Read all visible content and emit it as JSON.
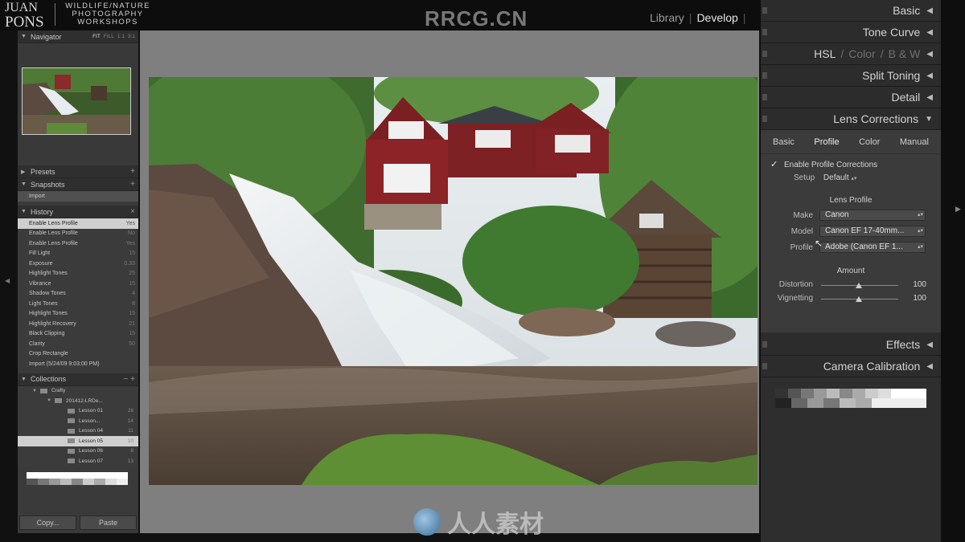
{
  "top": {
    "brand_line1": "JUAN",
    "brand_line2": "PONS",
    "tagline_1": "WILDLIFE/NATURE",
    "tagline_2": "PHOTOGRAPHY",
    "tagline_3": "WORKSHOPS",
    "watermark": "RRCG.CN",
    "modules": [
      "Library",
      "Develop"
    ],
    "active_module": "Develop",
    "separator": "|"
  },
  "navigator": {
    "title": "Navigator",
    "zoom": [
      "FIT",
      "FILL",
      "1:1",
      "3:1"
    ]
  },
  "presets": {
    "title": "Presets"
  },
  "snapshots": {
    "title": "Snapshots",
    "items": [
      "Import"
    ]
  },
  "history": {
    "title": "History",
    "items": [
      {
        "label": "Enable Lens Profile",
        "value": "Yes"
      },
      {
        "label": "Enable Lens Profile",
        "value": "No"
      },
      {
        "label": "Enable Lens Profile",
        "value": "Yes"
      },
      {
        "label": "Fill Light",
        "value": "15"
      },
      {
        "label": "Exposure",
        "value": "0.33"
      },
      {
        "label": "Highlight Tones",
        "value": "25"
      },
      {
        "label": "Vibrance",
        "value": "15"
      },
      {
        "label": "Shadow Tones",
        "value": "4"
      },
      {
        "label": "Light Tones",
        "value": "8"
      },
      {
        "label": "Highlight Tones",
        "value": "15"
      },
      {
        "label": "Highlight Recovery",
        "value": "21"
      },
      {
        "label": "Black Clipping",
        "value": "15"
      },
      {
        "label": "Clarity",
        "value": "50"
      },
      {
        "label": "Crop Rectangle",
        "value": ""
      },
      {
        "label": "Import (5/24/09 9:03:00 PM)",
        "value": ""
      }
    ]
  },
  "collections": {
    "title": "Collections",
    "items": [
      {
        "label": "Crafty",
        "count": "",
        "level": 1
      },
      {
        "label": "201412-LRDe...",
        "count": "",
        "level": 2
      },
      {
        "label": "Lesson 01",
        "count": "28",
        "level": 3
      },
      {
        "label": "Lesson...",
        "count": "14",
        "level": 3
      },
      {
        "label": "Lesson 04",
        "count": "11",
        "level": 3
      },
      {
        "label": "Lesson 05",
        "count": "10",
        "level": 3
      },
      {
        "label": "Lesson 06",
        "count": "8",
        "level": 3
      },
      {
        "label": "Lesson 07",
        "count": "13",
        "level": 3
      }
    ],
    "selected_index": 5
  },
  "left_buttons": {
    "copy": "Copy...",
    "paste": "Paste"
  },
  "center_watermark": "人人素材",
  "right": {
    "basic": "Basic",
    "tone_curve": "Tone Curve",
    "hsl": "HSL",
    "color": "Color",
    "bw": "B & W",
    "hsl_sep": "/",
    "split_toning": "Split Toning",
    "detail": "Detail",
    "lens_corrections": "Lens Corrections",
    "effects": "Effects",
    "camera_calibration": "Camera Calibration",
    "lens": {
      "tabs": [
        "Basic",
        "Profile",
        "Color",
        "Manual"
      ],
      "active_tab": "Profile",
      "enable_label": "Enable Profile Corrections",
      "enable_checked": true,
      "setup_label": "Setup",
      "setup_value": "Default",
      "lens_profile_title": "Lens Profile",
      "make_label": "Make",
      "make_value": "Canon",
      "model_label": "Model",
      "model_value": "Canon EF 17-40mm...",
      "profile_label": "Profile",
      "profile_value": "Adobe (Canon EF 1...",
      "amount_title": "Amount",
      "distortion_label": "Distortion",
      "distortion_value": "100",
      "vignetting_label": "Vignetting",
      "vignetting_value": "100"
    }
  },
  "icons": {
    "collapse": "triangle-left-icon",
    "expand": "triangle-down-icon",
    "check": "checkmark-icon"
  }
}
